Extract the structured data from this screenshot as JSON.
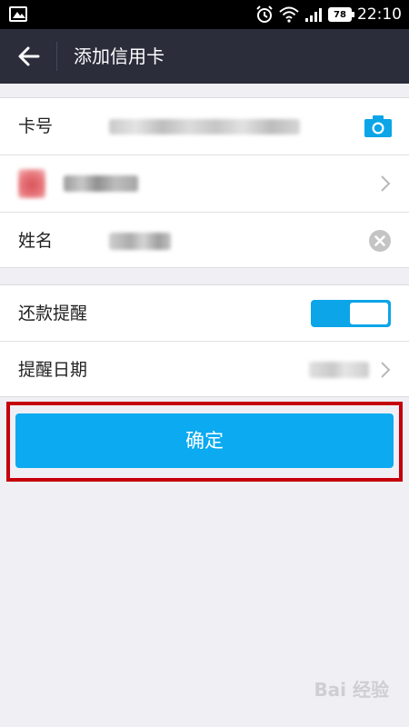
{
  "status_bar": {
    "time": "22:10",
    "battery": "78",
    "icons": [
      "image-icon",
      "alarm-icon",
      "wifi-icon",
      "signal-icon",
      "battery-icon"
    ]
  },
  "header": {
    "title": "添加信用卡",
    "back_icon": "arrow-left-icon"
  },
  "card_form": {
    "card_number_label": "卡号",
    "name_label": "姓名",
    "camera_icon": "camera-icon",
    "clear_icon": "clear-icon"
  },
  "reminder": {
    "repayment_label": "还款提醒",
    "repayment_on": true,
    "date_label": "提醒日期"
  },
  "confirm_label": "确定",
  "watermark": "Bai 经验",
  "colors": {
    "accent": "#0caaf0",
    "header_bg": "#2b2d3b",
    "highlight_border": "#c5000b",
    "page_bg": "#efeff4"
  }
}
